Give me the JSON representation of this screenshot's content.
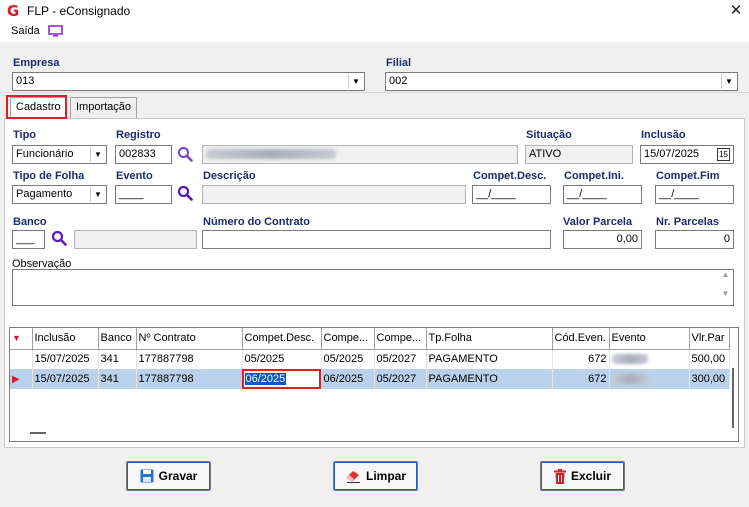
{
  "window": {
    "title": "FLP - eConsignado",
    "logo": "G"
  },
  "menu": {
    "saida": "Saída"
  },
  "empresa": {
    "label": "Empresa",
    "value": "013"
  },
  "filial": {
    "label": "Filial",
    "value": "002"
  },
  "tabs": [
    {
      "label": "Cadastro"
    },
    {
      "label": "Importação"
    }
  ],
  "form": {
    "tipo": {
      "label": "Tipo",
      "value": "Funcionário"
    },
    "registro": {
      "label": "Registro",
      "value": "002833"
    },
    "situacao": {
      "label": "Situação",
      "value": "ATIVO"
    },
    "inclusao": {
      "label": "Inclusão",
      "value": "15/07/2025"
    },
    "tipo_folha": {
      "label": "Tipo de Folha",
      "value": "Pagamento"
    },
    "evento": {
      "label": "Evento",
      "value": "____"
    },
    "descricao": {
      "label": "Descrição",
      "value": ""
    },
    "compet_desc": {
      "label": "Compet.Desc.",
      "value": "__/____"
    },
    "compet_ini": {
      "label": "Compet.Ini.",
      "value": "__/____"
    },
    "compet_fim": {
      "label": "Compet.Fim",
      "value": "__/____"
    },
    "banco": {
      "label": "Banco",
      "value": "___"
    },
    "numero_contrato": {
      "label": "Número do Contrato",
      "value": ""
    },
    "valor_parcela": {
      "label": "Valor Parcela",
      "value": "0,00"
    },
    "nr_parcelas": {
      "label": "Nr. Parcelas",
      "value": "0"
    },
    "observacao": {
      "label": "Observação",
      "value": ""
    }
  },
  "grid": {
    "columns": [
      "Inclusão",
      "Banco",
      "Nº Contrato",
      "Compet.Desc.",
      "Compe...",
      "Compe...",
      "Tp.Folha",
      "Cód.Even.",
      "Evento",
      "Vlr.Par"
    ],
    "rows": [
      [
        "15/07/2025",
        "341",
        "177887798",
        "05/2025",
        "05/2025",
        "05/2027",
        "PAGAMENTO",
        "672",
        "",
        "500,00"
      ],
      [
        "15/07/2025",
        "341",
        "177887798",
        "06/2025",
        "06/2025",
        "05/2027",
        "PAGAMENTO",
        "672",
        "",
        "300,00"
      ]
    ]
  },
  "buttons": {
    "gravar": "Gravar",
    "limpar": "Limpar",
    "excluir": "Excluir"
  },
  "colors": {
    "label": "#1a2c6b",
    "accent": "#7a3fd0",
    "highlight": "#e02020",
    "selected_row": "#b9d1ea"
  }
}
